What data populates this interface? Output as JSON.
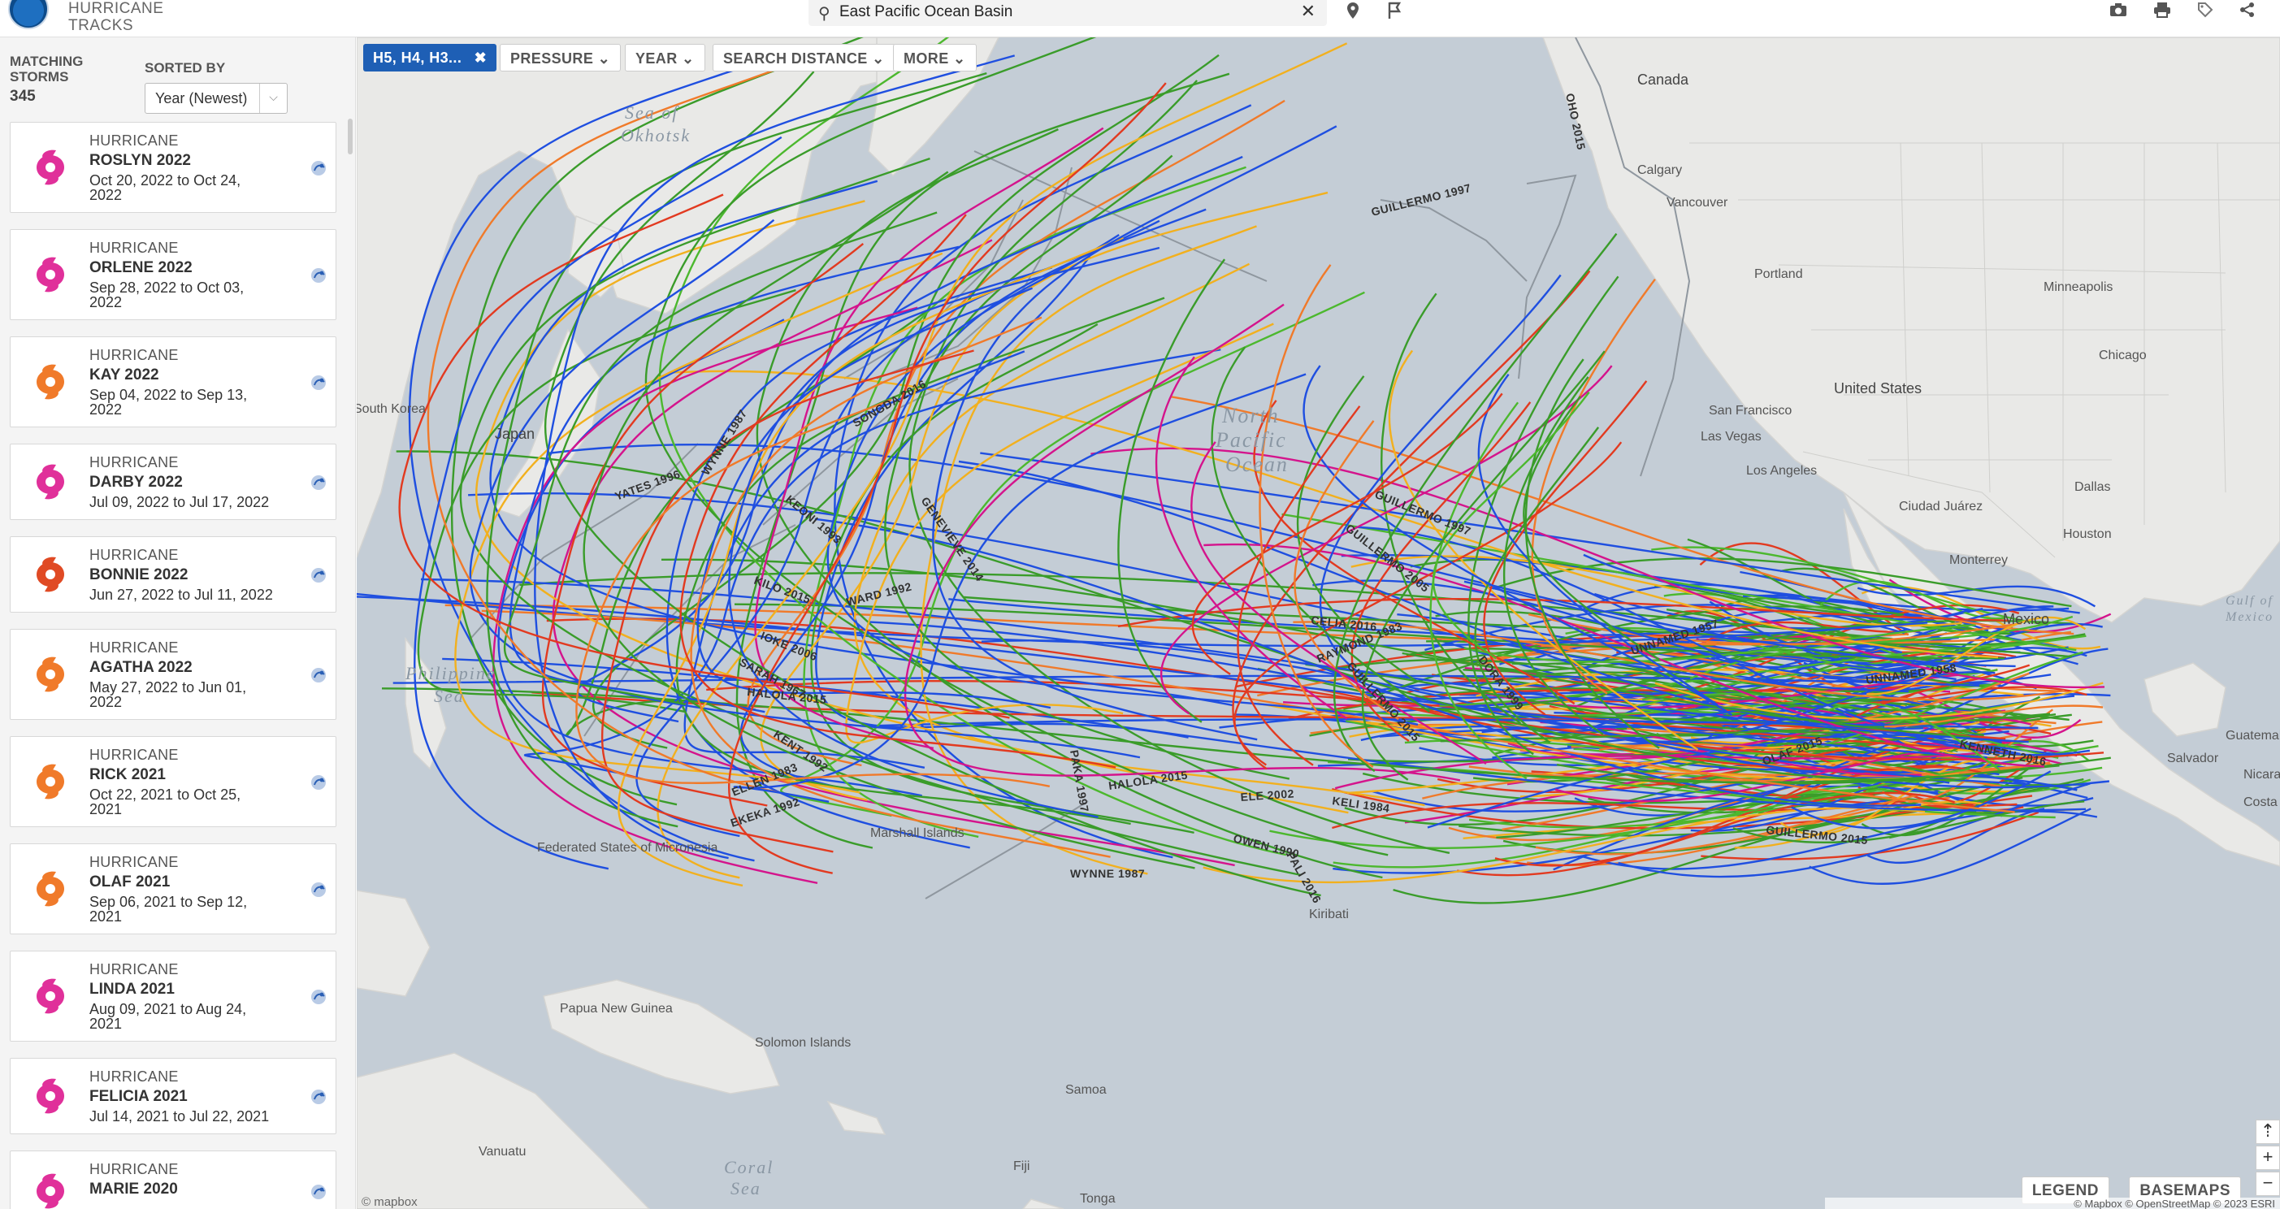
{
  "header": {
    "logo_text": "NOAA",
    "app_title_line1": "HURRICANE",
    "app_title_line2": "TRACKS",
    "search_value": "East Pacific Ocean Basin",
    "tools": [
      "location-pin-icon",
      "flag-icon",
      "camera-icon",
      "print-icon",
      "tag-icon",
      "share-icon"
    ]
  },
  "sidebar": {
    "matching_label_1": "MATCHING",
    "matching_label_2": "STORMS",
    "matching_count": "345",
    "sorted_label": "SORTED BY",
    "sort_value": "Year (Newest)",
    "storms": [
      {
        "type": "HURRICANE",
        "name": "ROSLYN 2022",
        "dates": "Oct 20, 2022 to Oct 24, 2022",
        "color": "#e0309a"
      },
      {
        "type": "HURRICANE",
        "name": "ORLENE 2022",
        "dates": "Sep 28, 2022 to Oct 03, 2022",
        "color": "#e0309a"
      },
      {
        "type": "HURRICANE",
        "name": "KAY 2022",
        "dates": "Sep 04, 2022 to Sep 13, 2022",
        "color": "#f07a2a"
      },
      {
        "type": "HURRICANE",
        "name": "DARBY 2022",
        "dates": "Jul 09, 2022 to Jul 17, 2022",
        "color": "#e0309a"
      },
      {
        "type": "HURRICANE",
        "name": "BONNIE 2022",
        "dates": "Jun 27, 2022 to Jul 11, 2022",
        "color": "#e04a24"
      },
      {
        "type": "HURRICANE",
        "name": "AGATHA 2022",
        "dates": "May 27, 2022 to Jun 01, 2022",
        "color": "#f07a2a"
      },
      {
        "type": "HURRICANE",
        "name": "RICK 2021",
        "dates": "Oct 22, 2021 to Oct 25, 2021",
        "color": "#f07a2a"
      },
      {
        "type": "HURRICANE",
        "name": "OLAF 2021",
        "dates": "Sep 06, 2021 to Sep 12, 2021",
        "color": "#f07a2a"
      },
      {
        "type": "HURRICANE",
        "name": "LINDA 2021",
        "dates": "Aug 09, 2021 to Aug 24, 2021",
        "color": "#e0309a"
      },
      {
        "type": "HURRICANE",
        "name": "FELICIA 2021",
        "dates": "Jul 14, 2021 to Jul 22, 2021",
        "color": "#e0309a"
      },
      {
        "type": "HURRICANE",
        "name": "MARIE 2020",
        "dates": "",
        "color": "#e0309a"
      }
    ]
  },
  "filters": {
    "active_chip": "H5, H4, H3...",
    "chips": [
      "PRESSURE",
      "YEAR",
      "SEARCH DISTANCE",
      "MORE"
    ]
  },
  "map": {
    "legend_button": "LEGEND",
    "basemaps_button": "BASEMAPS",
    "attribution": "© mapbox",
    "attribution_right": "© Mapbox © OpenStreetMap   © 2023 ESRI",
    "ocean_labels": [
      "Sea of",
      "Okhotsk",
      "North",
      "Pacific",
      "Ocean",
      "Philippine",
      "Sea",
      "Coral",
      "Sea",
      "Gulf of",
      "Mexico"
    ],
    "geo_labels": [
      "Canada",
      "United States",
      "Mexico",
      "Japan",
      "Papua New Guinea",
      "Kiribati",
      "Federated States of Micronesia",
      "Marshall Islands",
      "Solomon Islands",
      "Samoa",
      "Fiji",
      "Tonga",
      "Vanuatu",
      "South Korea",
      "Guatemala",
      "Nicaragua",
      "Costa Rica",
      "Salvador",
      "Houston",
      "Dallas",
      "Chicago",
      "Minneapolis",
      "Portland",
      "San Francisco",
      "Los Angeles",
      "Calgary",
      "Vancouver",
      "Las Vegas",
      "Ciudad Juárez",
      "Monterrey"
    ],
    "track_labels": [
      "OHO 2015",
      "GUILLERMO 1997",
      "SONGDA 2016",
      "WYNNE 1987",
      "YATES 1996",
      "KEONI 1993",
      "GENEVIEVE 2014",
      "KILO 2015",
      "WARD 1992",
      "IOKE 2006",
      "SARAH 1967",
      "HALOLA 2015",
      "KENT 1992",
      "ELLEN 1983",
      "EKEKA 1992",
      "PAKA 1997",
      "HALOLA 2015",
      "ELE 2002",
      "KELI 1984",
      "OWEN 1990",
      "PALI 2016",
      "WYNNE 1987",
      "CELIA 2016",
      "RAYMOND 1983",
      "GUILLERMO 2015",
      "UNNAMED 1957",
      "UNNAMED 1958",
      "KENNETH 2016",
      "OLAF 2015",
      "DORA 1999",
      "GUILLERMO 2015",
      "GUILLERMO 1997",
      "GUILLERMO 2005"
    ]
  }
}
